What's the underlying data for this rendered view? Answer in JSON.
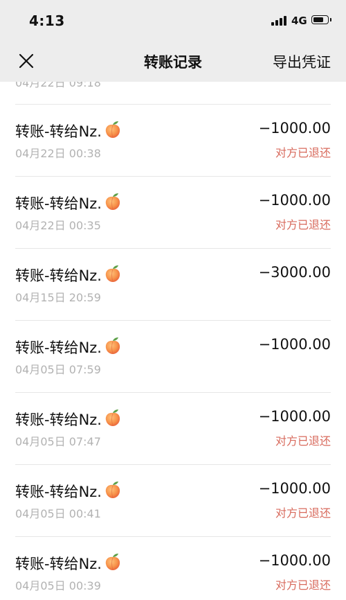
{
  "status_bar": {
    "time": "4:13",
    "network": "4G",
    "battery_level": 0.75
  },
  "header": {
    "title": "转账记录",
    "export_label": "导出凭证"
  },
  "list": {
    "peek_date": "04月22日 09:18",
    "records": [
      {
        "description": "转账-转给Nz.",
        "date": "04月22日 00:38",
        "amount": "−1000.00",
        "status": "对方已退还"
      },
      {
        "description": "转账-转给Nz.",
        "date": "04月22日 00:35",
        "amount": "−1000.00",
        "status": "对方已退还"
      },
      {
        "description": "转账-转给Nz.",
        "date": "04月15日 20:59",
        "amount": "−3000.00",
        "status": ""
      },
      {
        "description": "转账-转给Nz.",
        "date": "04月05日 07:59",
        "amount": "−1000.00",
        "status": ""
      },
      {
        "description": "转账-转给Nz.",
        "date": "04月05日 07:47",
        "amount": "−1000.00",
        "status": "对方已退还"
      },
      {
        "description": "转账-转给Nz.",
        "date": "04月05日 00:41",
        "amount": "−1000.00",
        "status": "对方已退还"
      },
      {
        "description": "转账-转给Nz.",
        "date": "04月05日 00:39",
        "amount": "−1000.00",
        "status": "对方已退还"
      }
    ]
  },
  "icons": {
    "close": "close-icon",
    "record_emoji": "peach-icon"
  },
  "colors": {
    "header_bg": "#ededed",
    "refund_status": "#d86a5c",
    "secondary_text": "#b2b2b2"
  }
}
